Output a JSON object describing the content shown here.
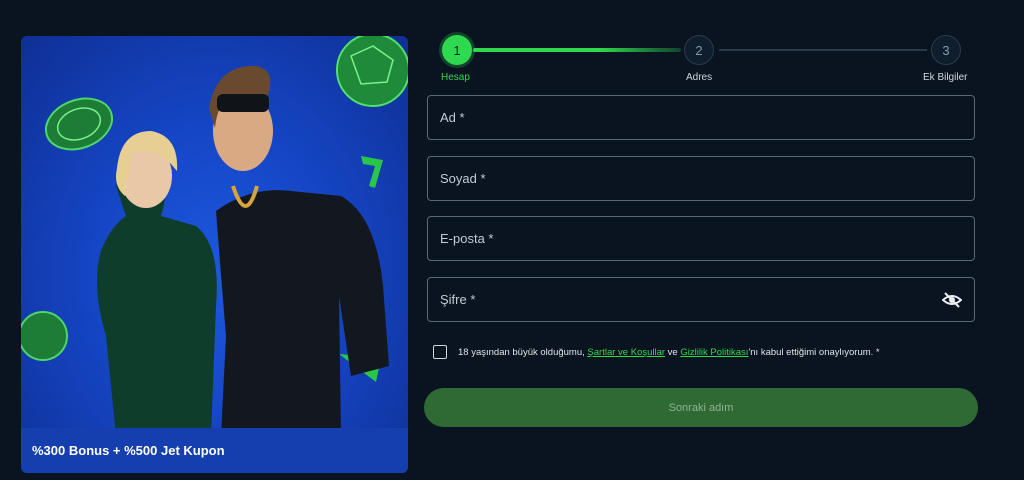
{
  "promo": {
    "caption": "%300 Bonus + %500 Jet Kupon"
  },
  "stepper": {
    "steps": [
      {
        "number": "1",
        "label": "Hesap",
        "state": "active"
      },
      {
        "number": "2",
        "label": "Adres",
        "state": "inactive"
      },
      {
        "number": "3",
        "label": "Ek Bilgiler",
        "state": "inactive"
      }
    ]
  },
  "form": {
    "first_name": {
      "placeholder": "Ad *",
      "value": ""
    },
    "last_name": {
      "placeholder": "Soyad *",
      "value": ""
    },
    "email": {
      "placeholder": "E-posta *",
      "value": ""
    },
    "password": {
      "placeholder": "Şifre *",
      "value": ""
    },
    "consent": {
      "prefix": "18 yaşından büyük olduğumu, ",
      "terms_link": "Şartlar ve Koşullar",
      "middle": " ve ",
      "privacy_link": "Gizlilik Politikası",
      "suffix": "'nı kabul ettiğimi onaylıyorum. *"
    },
    "next_label": "Sonraki adım"
  },
  "colors": {
    "accent": "#2fd94f",
    "background": "#0a1420",
    "button": "#2f6a34",
    "promo_blue": "#1545c4"
  },
  "icons": {
    "password_toggle": "eye-slash-icon"
  }
}
